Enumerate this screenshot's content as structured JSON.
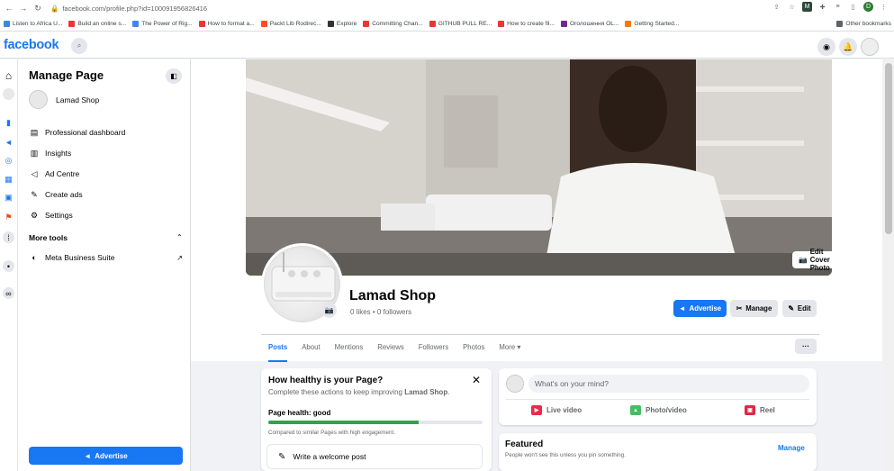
{
  "browser": {
    "url": "facebook.com/profile.php?id=100091956826416",
    "profile_initial": "D",
    "other_bookmarks": "Other bookmarks",
    "bookmarks": [
      {
        "label": "Listen to Africa U...",
        "color": "#3a8bd6"
      },
      {
        "label": "Build an online s...",
        "color": "#e53935"
      },
      {
        "label": "The Power of Rig...",
        "color": "#4285f4"
      },
      {
        "label": "How to format a...",
        "color": "#e53935"
      },
      {
        "label": "Packt Lib Rodirec...",
        "color": "#f4511e"
      },
      {
        "label": "Explore",
        "color": "#333333"
      },
      {
        "label": "Committing Chan...",
        "color": "#e53935"
      },
      {
        "label": "GITHUB PULL RE...",
        "color": "#e53935"
      },
      {
        "label": "How to create fil...",
        "color": "#e53935"
      },
      {
        "label": "Оголошення OL...",
        "color": "#6e2b8f"
      },
      {
        "label": "Getting Started...",
        "color": "#f57c00"
      }
    ]
  },
  "fb": {
    "logo": "facebook"
  },
  "sidebar": {
    "title": "Manage Page",
    "page_name": "Lamad Shop",
    "items": [
      {
        "label": "Professional dashboard",
        "icon": "dashboard-icon"
      },
      {
        "label": "Insights",
        "icon": "insights-icon"
      },
      {
        "label": "Ad Centre",
        "icon": "megaphone-icon"
      },
      {
        "label": "Create ads",
        "icon": "pencil-icon"
      },
      {
        "label": "Settings",
        "icon": "gear-icon"
      }
    ],
    "more_tools": "More tools",
    "meta_suite": "Meta Business Suite",
    "advertise": "Advertise"
  },
  "page": {
    "name": "Lamad Shop",
    "stats": "0 likes • 0 followers",
    "edit_cover": "Edit Cover Photo",
    "buttons": {
      "advertise": "Advertise",
      "manage": "Manage",
      "edit": "Edit"
    },
    "tabs": [
      "Posts",
      "About",
      "Mentions",
      "Reviews",
      "Followers",
      "Photos",
      "More"
    ],
    "tab_more_dots": "···"
  },
  "health": {
    "title": "How healthy is your Page?",
    "subtitle_prefix": "Complete these actions to keep improving ",
    "subtitle_page": "Lamad Shop",
    "status": "Page health: good",
    "progress": 0.7,
    "compare": "Compared to similar Pages with high engagement.",
    "task": "Write a welcome post"
  },
  "composer": {
    "placeholder": "What's on your mind?",
    "live": "Live video",
    "photo": "Photo/video",
    "reel": "Reel"
  },
  "featured": {
    "title": "Featured",
    "subtitle": "People won't see this unless you pin something.",
    "manage": "Manage"
  },
  "colors": {
    "brand": "#1877f2",
    "health": "#31a24c"
  }
}
